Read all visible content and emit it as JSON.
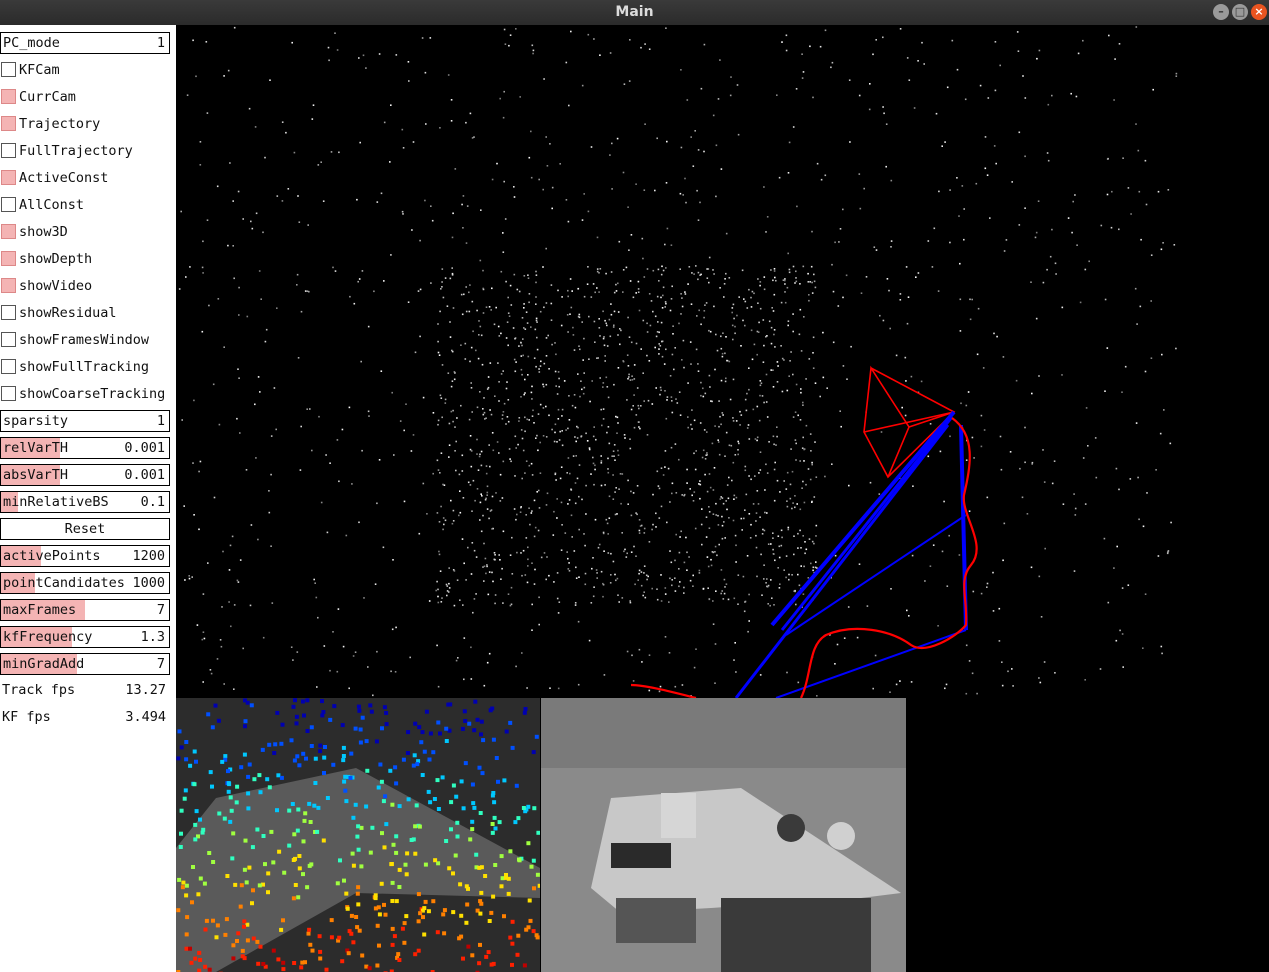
{
  "window": {
    "title": "Main"
  },
  "window_buttons": {
    "minimize": "–",
    "maximize": "□",
    "close": "×"
  },
  "panel": {
    "pc_mode": {
      "label": "PC_mode",
      "value": "1"
    },
    "checkboxes": [
      {
        "label": "KFCam",
        "checked": false
      },
      {
        "label": "CurrCam",
        "checked": true
      },
      {
        "label": "Trajectory",
        "checked": true
      },
      {
        "label": "FullTrajectory",
        "checked": false
      },
      {
        "label": "ActiveConst",
        "checked": true
      },
      {
        "label": "AllConst",
        "checked": false
      },
      {
        "label": "show3D",
        "checked": true
      },
      {
        "label": "showDepth",
        "checked": true
      },
      {
        "label": "showVideo",
        "checked": true
      },
      {
        "label": "showResidual",
        "checked": false
      },
      {
        "label": "showFramesWindow",
        "checked": false
      },
      {
        "label": "showFullTracking",
        "checked": false
      },
      {
        "label": "showCoarseTracking",
        "checked": false
      }
    ],
    "sparsity": {
      "label": "sparsity",
      "value": "1",
      "level": 0
    },
    "relVarTH": {
      "label": "relVarTH",
      "value": "0.001",
      "level": 0.35
    },
    "absVarTH": {
      "label": "absVarTH",
      "value": "0.001",
      "level": 0.35
    },
    "minRelativeBS": {
      "label": "minRelativeBS",
      "value": "0.1",
      "level": 0.1
    },
    "reset": {
      "label": "Reset"
    },
    "activePoints": {
      "label": "activePoints",
      "value": "1200",
      "level": 0.24
    },
    "pointCandidates": {
      "label": "pointCandidates",
      "value": "1000",
      "level": 0.2
    },
    "maxFrames": {
      "label": "maxFrames",
      "value": "7",
      "level": 0.5
    },
    "kfFrequency": {
      "label": "kfFrequency",
      "value": "1.3",
      "level": 0.42
    },
    "minGradAdd": {
      "label": "minGradAdd",
      "value": "7",
      "level": 0.45
    },
    "track_fps": {
      "label": "Track fps",
      "value": "13.27"
    },
    "kf_fps": {
      "label": "KF fps",
      "value": "3.494"
    }
  },
  "colors": {
    "slider_fill": "#f4b4b4",
    "camera_frustum": "#ff0000",
    "constraint_lines": "#0000ff",
    "trajectory": "#ff0000"
  }
}
